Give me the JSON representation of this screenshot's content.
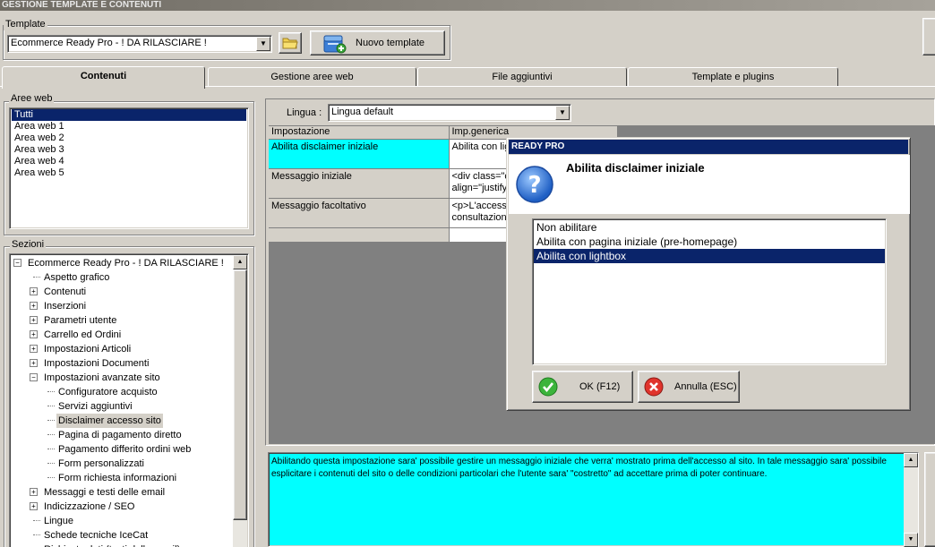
{
  "window": {
    "title": "GESTIONE TEMPLATE E CONTENUTI"
  },
  "template": {
    "group_label": "Template",
    "selected": "Ecommerce Ready Pro - ! DA RILASCIARE !",
    "new_button": "Nuovo template"
  },
  "tabs": [
    {
      "label": "Contenuti",
      "active": true
    },
    {
      "label": "Gestione aree web",
      "active": false
    },
    {
      "label": "File aggiuntivi",
      "active": false
    },
    {
      "label": "Template e plugins",
      "active": false
    }
  ],
  "areeweb": {
    "label": "Aree web",
    "items": [
      "Tutti",
      "Area web 1",
      "Area web 2",
      "Area web 3",
      "Area web 4",
      "Area web 5"
    ],
    "selected": "Tutti"
  },
  "sezioni": {
    "label": "Sezioni",
    "tree": [
      {
        "label": "Ecommerce Ready Pro - ! DA RILASCIARE !",
        "level": 0,
        "expander": "minus"
      },
      {
        "label": "Aspetto grafico",
        "level": 1,
        "expander": ""
      },
      {
        "label": "Contenuti",
        "level": 1,
        "expander": "plus"
      },
      {
        "label": "Inserzioni",
        "level": 1,
        "expander": "plus"
      },
      {
        "label": "Parametri utente",
        "level": 1,
        "expander": "plus"
      },
      {
        "label": "Carrello ed Ordini",
        "level": 1,
        "expander": "plus"
      },
      {
        "label": "Impostazioni Articoli",
        "level": 1,
        "expander": "plus"
      },
      {
        "label": "Impostazioni Documenti",
        "level": 1,
        "expander": "plus"
      },
      {
        "label": "Impostazioni avanzate sito",
        "level": 1,
        "expander": "minus"
      },
      {
        "label": "Configuratore acquisto",
        "level": 2,
        "expander": ""
      },
      {
        "label": "Servizi aggiuntivi",
        "level": 2,
        "expander": ""
      },
      {
        "label": "Disclaimer accesso sito",
        "level": 2,
        "expander": "",
        "selected": true
      },
      {
        "label": "Pagina di pagamento diretto",
        "level": 2,
        "expander": ""
      },
      {
        "label": "Pagamento differito ordini web",
        "level": 2,
        "expander": ""
      },
      {
        "label": "Form personalizzati",
        "level": 2,
        "expander": ""
      },
      {
        "label": "Form richiesta informazioni",
        "level": 2,
        "expander": ""
      },
      {
        "label": "Messaggi e testi delle email",
        "level": 1,
        "expander": "plus"
      },
      {
        "label": "Indicizzazione / SEO",
        "level": 1,
        "expander": "plus"
      },
      {
        "label": "Lingue",
        "level": 1,
        "expander": ""
      },
      {
        "label": "Schede tecniche IceCat",
        "level": 1,
        "expander": ""
      },
      {
        "label": "Richieste dati (testi delle email)",
        "level": 1,
        "expander": ""
      }
    ]
  },
  "lingua": {
    "label": "Lingua :",
    "selected": "Lingua default"
  },
  "grid": {
    "headers": [
      "Impostazione",
      "Imp.generica"
    ],
    "rows": [
      {
        "name": "Abilita disclaimer iniziale",
        "value": "Abilita con lig",
        "selected": true
      },
      {
        "name": "Messaggio iniziale",
        "value": "<div class=\"c\nalign=\"justify\""
      },
      {
        "name": "Messaggio facoltativo",
        "value": "<p>L'access\nconsultazione"
      },
      {
        "name": "",
        "value": ""
      }
    ]
  },
  "description": "Abilitando questa impostazione sara' possibile gestire un messaggio iniziale che verra' mostrato prima dell'accesso al sito. In tale messaggio sara' possibile esplicitare i contenuti del sito o delle condizioni particolari che l'utente sara' \"costretto\" ad accettare prima di poter continuare.",
  "dialog": {
    "title": "READY PRO",
    "heading": "Abilita disclaimer iniziale",
    "options": [
      "Non abilitare",
      "Abilita con pagina iniziale (pre-homepage)",
      "Abilita con lightbox"
    ],
    "selected_index": 2,
    "ok_label": "OK (F12)",
    "cancel_label": "Annulla (ESC)"
  },
  "colors": {
    "highlight": "#0a246a",
    "cyan": "#00ffff",
    "dark_area": "#808080"
  }
}
